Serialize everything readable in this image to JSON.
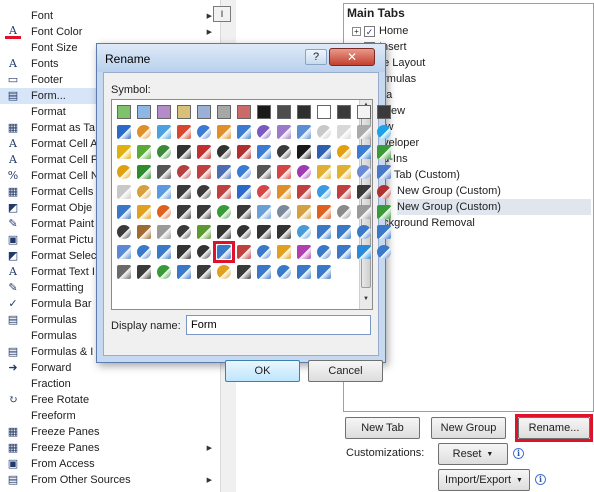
{
  "left_list": {
    "size_combo": "I",
    "items": [
      {
        "label": "Font",
        "icon": "font-icon",
        "glyph": "",
        "arrow": true
      },
      {
        "label": "Font Color",
        "icon": "font-color-icon",
        "glyph": "A",
        "arrow": true
      },
      {
        "label": "Font Size",
        "icon": "font-size-icon",
        "glyph": "",
        "arrow": true
      },
      {
        "label": "Fonts",
        "icon": "fonts-icon",
        "glyph": "A",
        "arrow": true
      },
      {
        "label": "Footer",
        "icon": "footer-icon",
        "glyph": "▭",
        "arrow": true
      },
      {
        "label": "Form...",
        "icon": "form-icon",
        "glyph": "▤",
        "arrow": false,
        "selected": true
      },
      {
        "label": "Format",
        "icon": "format-icon",
        "glyph": "",
        "arrow": true
      },
      {
        "label": "Format as Ta",
        "icon": "format-as-table-icon",
        "glyph": "▦",
        "arrow": true
      },
      {
        "label": "Format Cell A",
        "icon": "format-cell-alignment-icon",
        "glyph": "A",
        "arrow": false
      },
      {
        "label": "Format Cell F",
        "icon": "format-cell-font-icon",
        "glyph": "A",
        "arrow": false
      },
      {
        "label": "Format Cell N",
        "icon": "format-cell-number-icon",
        "glyph": "%",
        "arrow": false
      },
      {
        "label": "Format Cells",
        "icon": "format-cells-icon",
        "glyph": "▦",
        "arrow": false
      },
      {
        "label": "Format Obje",
        "icon": "format-object-icon",
        "glyph": "◩",
        "arrow": false
      },
      {
        "label": "Format Paint",
        "icon": "format-painter-icon",
        "glyph": "✎",
        "arrow": false
      },
      {
        "label": "Format Pictu",
        "icon": "format-picture-icon",
        "glyph": "▣",
        "arrow": false
      },
      {
        "label": "Format Selec",
        "icon": "format-selection-icon",
        "glyph": "◩",
        "arrow": false
      },
      {
        "label": "Format Text I",
        "icon": "format-text-icon",
        "glyph": "A",
        "arrow": false
      },
      {
        "label": "Formatting",
        "icon": "formatting-icon",
        "glyph": "✎",
        "arrow": true
      },
      {
        "label": "Formula Bar",
        "icon": "formula-bar-icon",
        "glyph": "✓",
        "arrow": false
      },
      {
        "label": "Formulas",
        "icon": "formulas-icon",
        "glyph": "▤",
        "arrow": true
      },
      {
        "label": "Formulas",
        "icon": "formulas-2-icon",
        "glyph": "",
        "arrow": true
      },
      {
        "label": "Formulas & I",
        "icon": "formulas-and-icon",
        "glyph": "▤",
        "arrow": true
      },
      {
        "label": "Forward",
        "icon": "forward-icon",
        "glyph": "➜",
        "arrow": false
      },
      {
        "label": "Fraction",
        "icon": "fraction-icon",
        "glyph": "",
        "arrow": false
      },
      {
        "label": "Free Rotate",
        "icon": "free-rotate-icon",
        "glyph": "↻",
        "arrow": false
      },
      {
        "label": "Freeform",
        "icon": "freeform-icon",
        "glyph": "",
        "arrow": false
      },
      {
        "label": "Freeze Panes",
        "icon": "freeze-panes-icon",
        "glyph": "▦",
        "arrow": false
      },
      {
        "label": "Freeze Panes",
        "icon": "freeze-panes-2-icon",
        "glyph": "▦",
        "arrow": true
      },
      {
        "label": "From Access",
        "icon": "from-access-icon",
        "glyph": "▣",
        "arrow": false
      },
      {
        "label": "From Other Sources",
        "icon": "from-other-sources-icon",
        "glyph": "▤",
        "arrow": true
      }
    ]
  },
  "tabs_tree": {
    "header": "Main Tabs",
    "rows": [
      {
        "label": "Home",
        "expander": "+",
        "check": true
      },
      {
        "label": "Insert",
        "expander": "+",
        "check": true
      },
      {
        "label": "ge Layout",
        "expander": "",
        "check": false
      },
      {
        "label": "ormulas",
        "expander": "",
        "check": false
      },
      {
        "label": "ata",
        "expander": "",
        "check": false
      },
      {
        "label": "eview",
        "expander": "",
        "check": false
      },
      {
        "label": "iew",
        "expander": "",
        "check": false
      },
      {
        "label": "eveloper",
        "expander": "",
        "check": false
      },
      {
        "label": "dd-Ins",
        "expander": "",
        "check": false
      },
      {
        "label": "ew Tab (Custom)",
        "expander": "",
        "check": false
      },
      {
        "label": "New Group (Custom)",
        "expander": "",
        "check": false
      },
      {
        "label": "New Group (Custom)",
        "expander": "",
        "check": false,
        "selected": true
      },
      {
        "label": "ackground Removal",
        "expander": "",
        "check": false
      }
    ]
  },
  "bottom": {
    "new_tab": "New Tab",
    "new_group": "New Group",
    "rename": "Rename...",
    "customizations": "Customizations:",
    "reset": "Reset",
    "import_export": "Import/Export",
    "info": "i"
  },
  "dialog": {
    "title": "Rename",
    "help": "?",
    "close": "✕",
    "symbol_label": "Symbol:",
    "display_name_label": "Display name:",
    "display_name_value": "Form",
    "ok": "OK",
    "cancel": "Cancel",
    "selected_symbol_index": 103,
    "symbol_colors": [
      "#7ec36b",
      "#8fb7e6",
      "#b48cc9",
      "#d8c07a",
      "#9cb0d6",
      "#a7a7a7",
      "#cc6a6a",
      "#1a1a1a",
      "#4d4d4d",
      "#2f2f2f",
      "#ffffff",
      "#3a3a3a",
      "#f3f3f3",
      "#3a3a3a",
      "#2a6ac8",
      "#e0902a",
      "#4aa3e0",
      "#d9462f",
      "#3b7bd1",
      "#e0902a",
      "#3b7bd1",
      "#7a5ac0",
      "#9b7ac9",
      "#5a8ed6",
      "#c8c8c8",
      "#d8d8d8",
      "#aaaaaa",
      "#1ea1e6",
      "#e0b010",
      "#5aaa3a",
      "#3a8a3a",
      "#333333",
      "#c22f2f",
      "#333333",
      "#b03030",
      "#3b7bd1",
      "#3a3a3a",
      "#1a1a1a",
      "#2f5fb0",
      "#e0a010",
      "#3b7bd1",
      "#3a9a3a",
      "#e0a010",
      "#2e8b2e",
      "#555555",
      "#b34040",
      "#c04040",
      "#4d6db3",
      "#3b7bd1",
      "#555555",
      "#d64545",
      "#a03ab0",
      "#e0b030",
      "#e0b030",
      "#6a8ad6",
      "#4a78c8",
      "#c8c8c8",
      "#d4a040",
      "#5a9ae0",
      "#3a3a3a",
      "#3a3a3a",
      "#c04040",
      "#2a6ac8",
      "#d64545",
      "#e0902a",
      "#c04040",
      "#3b9be0",
      "#c04040",
      "#3a3a3a",
      "#b03030",
      "#3a78c8",
      "#e0a020",
      "#e06020",
      "#3a3a3a",
      "#3a3a3a",
      "#3a9a3a",
      "#3a3a3a",
      "#6aa0d8",
      "#7a8a9a",
      "#d4a040",
      "#e06020",
      "#8a8a8a",
      "#9a9a9a",
      "#3a9a3a",
      "#3a3a3a",
      "#a06a30",
      "#9a9a9a",
      "#3a3a3a",
      "#5a9a30",
      "#333333",
      "#333333",
      "#333333",
      "#333333",
      "#4a9ad8",
      "#3a78c8",
      "#3a78c8",
      "#3a78c8",
      "#3a78c8",
      "#5a8ad6",
      "#3a78c8",
      "#3a78c8",
      "#333333",
      "#333333",
      "#3a78c8",
      "#c04040",
      "#3a78c8",
      "#e0a020",
      "#b040b0",
      "#3a78c8",
      "#3a78c8",
      "#2a8ad8",
      "#3a78c8",
      "#6a6a6a",
      "#3a3a3a",
      "#3a9a3a",
      "#3a78c8",
      "#3a3a3a",
      "#e0a020",
      "#3a3a3a",
      "#3a78c8",
      "#3a78c8",
      "#3a78c8",
      "#3a78c8"
    ]
  }
}
